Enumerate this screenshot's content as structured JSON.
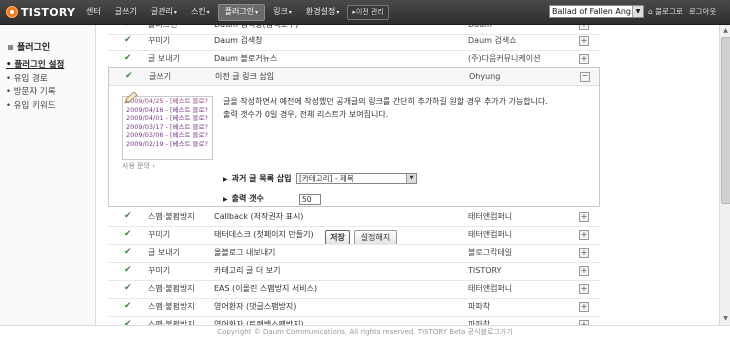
{
  "header": {
    "logo_text": "TISTORY",
    "nav": [
      {
        "label": "센터",
        "caret": ""
      },
      {
        "label": "글쓰기",
        "caret": ""
      },
      {
        "label": "글관리",
        "caret": "▾"
      },
      {
        "label": "스킨",
        "caret": "▾"
      },
      {
        "label": "플러그인",
        "caret": "▾",
        "active": true
      },
      {
        "label": "링크",
        "caret": "▾"
      },
      {
        "label": "환경설정",
        "caret": "▾"
      }
    ],
    "prev_admin_label": "▸이전 관리",
    "blog_select_value": "Ballad of Fallen Ang...",
    "blog_home_label": "⌂ 블로그로",
    "logout_label": "로그아웃"
  },
  "sidebar": {
    "title": "플러그인",
    "items": [
      "플러그인 설정",
      "유입 경로",
      "방문자 기록",
      "유입 키워드"
    ]
  },
  "plugins_top": [
    {
      "cat": "플러그인",
      "name": "Daum 검색창(검색도구)",
      "author": "Daum",
      "toggle": "+"
    },
    {
      "cat": "꾸미기",
      "name": "Daum 검색창",
      "author": "Daum 검색쇼",
      "toggle": "+"
    },
    {
      "cat": "글 보내기",
      "name": "Daum 블로거뉴스",
      "author": "(주)다음커뮤니케이션",
      "toggle": "+"
    }
  ],
  "detail": {
    "cat": "글쓰기",
    "name": "이전 글 링크 삽입",
    "author": "Ohyung",
    "toggle": "−",
    "preview_lines": [
      "2009/04/25 - [베스트 블로?",
      "2009/04/16 - [베스트 블로?",
      "2009/04/01 - [베스트 블로?",
      "2009/03/17 - [베스트 블로?",
      "2009/03/06 - [베스트 블로?",
      "2009/02/19 - [베스트 블로?"
    ],
    "usage_label": "사용 문의 ›",
    "description": "글을 작성하면서 예전에 작성했던 공개글의 링크를 간단히 추가하길 원할 경우 추가가 가능합니다. 출력 갯수가 0일 경우, 전체 리스트가 보여집니다.",
    "option1_label": "과거 글 목록 삽입",
    "option1_value": "[카테고리] - 제목",
    "option2_label": "출력 갯수",
    "option2_value": "50",
    "save_label": "저장",
    "cancel_label": "설정해지"
  },
  "plugins_bottom": [
    {
      "cat": "스팸·불펌방지",
      "name": "Callback (저작권자 표시)",
      "author": "태터앤컴퍼니",
      "toggle": "+"
    },
    {
      "cat": "꾸미기",
      "name": "태터데스크 (첫페이지 만들기)",
      "author": "태터앤컴퍼니",
      "toggle": "+"
    },
    {
      "cat": "글 보내기",
      "name": "올블로그 내보내기",
      "author": "블로그칵테일",
      "toggle": "+"
    },
    {
      "cat": "꾸미기",
      "name": "카테고리 글 더 보기",
      "author": "TISTORY",
      "toggle": "+"
    },
    {
      "cat": "스팸·불펌방지",
      "name": "EAS (이올린 스팸방지 서비스)",
      "author": "태터앤컴퍼니",
      "toggle": "+"
    },
    {
      "cat": "스팸·불펌방지",
      "name": "영어환자 (댓글스팸방지)",
      "author": "파파착",
      "toggle": "+"
    },
    {
      "cat": "스팸·불펌방지",
      "name": "영어환자 (트랙백스팸방지)",
      "author": "파파착",
      "toggle": "+"
    }
  ],
  "footer": {
    "text": "Copyright © Daum Communications. All rights reserved. TISTORY Beta 공식블로그가기"
  },
  "colors": {
    "topbar": "#3a3a3a",
    "logo": "#f07a1a",
    "check": "#3a8a3a"
  },
  "icons": {
    "check": "check-icon",
    "expand": "plus-box-icon",
    "collapse": "minus-box-icon"
  }
}
